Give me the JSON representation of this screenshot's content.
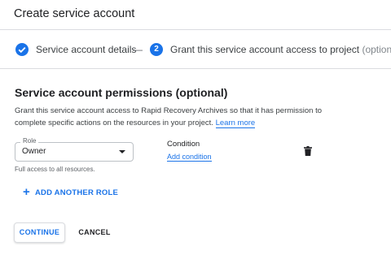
{
  "header": {
    "title": "Create service account"
  },
  "stepper": {
    "step1": {
      "label": "Service account details",
      "state": "complete",
      "icon": "check-icon"
    },
    "separator": "—",
    "step2": {
      "number": "2",
      "label": "Grant this service account access to project",
      "optional": "(optional)"
    }
  },
  "permissions": {
    "title": "Service account permissions (optional)",
    "description": "Grant this service account access to Rapid Recovery Archives so that it has permission to complete specific actions on the resources in your project.",
    "learn_more": "Learn more",
    "role": {
      "label": "Role",
      "value": "Owner",
      "helper": "Full access to all resources."
    },
    "condition": {
      "label": "Condition",
      "link": "Add condition"
    },
    "delete_icon": "trash-icon",
    "add_role": {
      "icon": "plus-icon",
      "label": "ADD ANOTHER ROLE"
    }
  },
  "actions": {
    "continue": "CONTINUE",
    "cancel": "CANCEL"
  },
  "colors": {
    "accent": "#1a73e8",
    "divider": "#dadce0"
  }
}
